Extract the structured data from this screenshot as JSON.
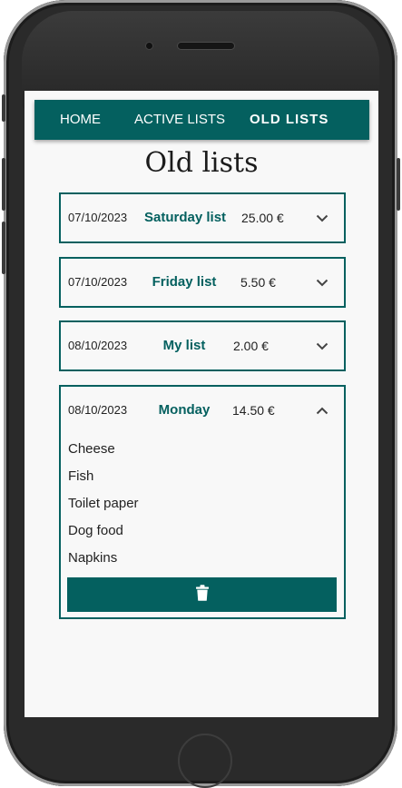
{
  "nav": {
    "items": [
      {
        "label": "HOME"
      },
      {
        "label": "ACTIVE LISTS"
      },
      {
        "label": "OLD LISTS"
      }
    ],
    "active_index": 2
  },
  "page_title": "Old lists",
  "lists": [
    {
      "date": "07/10/2023",
      "name": "Saturday list",
      "total": "25.00 €",
      "expanded": false
    },
    {
      "date": "07/10/2023",
      "name": "Friday list",
      "total": "5.50 €",
      "expanded": false
    },
    {
      "date": "08/10/2023",
      "name": "My list",
      "total": "2.00 €",
      "expanded": false
    },
    {
      "date": "08/10/2023",
      "name": "Monday",
      "total": "14.50 €",
      "expanded": true,
      "items": [
        "Cheese",
        "Fish",
        "Toilet paper",
        "Dog food",
        "Napkins"
      ]
    }
  ],
  "icons": {
    "collapsed": "chevron-down-icon",
    "expanded": "chevron-up-icon",
    "delete": "trash-icon"
  },
  "colors": {
    "brand": "#04605f",
    "background": "#f8f8f8",
    "frame": "#2a2a2a"
  }
}
